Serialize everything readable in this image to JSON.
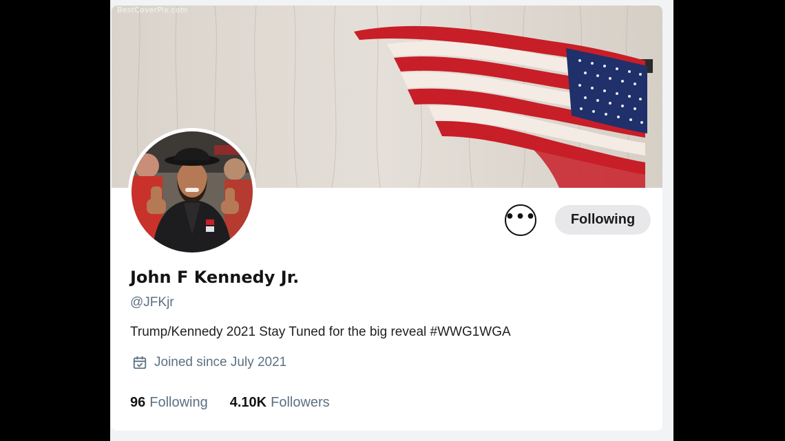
{
  "banner": {
    "watermark": "BestCoverPix.com",
    "flag_colors": {
      "red": "#c81e28",
      "white": "#f4ece4",
      "blue": "#20306a"
    }
  },
  "profile": {
    "name": "John F Kennedy Jr.",
    "handle": "@JFKjr",
    "bio": "Trump/Kennedy 2021 Stay Tuned for the big reveal #WWG1WGA",
    "joined": "Joined since July 2021"
  },
  "actions": {
    "more_icon": "more-icon",
    "follow_label": "Following"
  },
  "stats": {
    "following_count": "96",
    "following_label": "Following",
    "followers_count": "4.10K",
    "followers_label": "Followers"
  },
  "colors": {
    "accent_gray": "#5b7083",
    "button_bg": "#e8e8ea",
    "text": "#141414"
  }
}
